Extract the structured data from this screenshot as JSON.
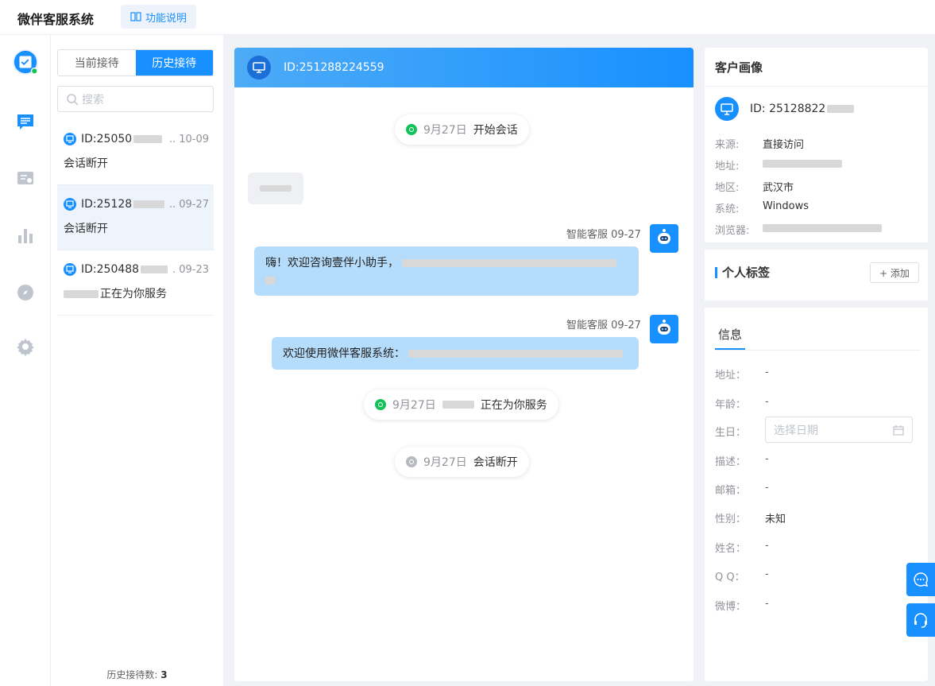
{
  "app": {
    "title": "微伴客服系统",
    "help_label": "功能说明"
  },
  "rail": {
    "items": [
      "reception",
      "chat",
      "ticket",
      "stats",
      "explore",
      "settings"
    ]
  },
  "list_panel": {
    "tabs": [
      {
        "label": "当前接待",
        "active": false
      },
      {
        "label": "历史接待",
        "active": true
      }
    ],
    "search_placeholder": "搜索",
    "sessions": [
      {
        "id": "ID:25050",
        "date": ".. 10-09",
        "message": "会话断开",
        "active": false
      },
      {
        "id": "ID:25128",
        "date": ".. 09-27",
        "message": "会话断开",
        "active": true
      },
      {
        "id": "ID:250488",
        "date": ". 09-23",
        "message": "正在为你服务",
        "active": false
      }
    ],
    "count_label": "历史接待数:",
    "count_value": "3"
  },
  "chat": {
    "header_id": "ID:251288224559",
    "system_start": {
      "date": "9月27日",
      "text": "开始会话"
    },
    "messages": [
      {
        "sender": "智能客服 09-27",
        "text": "嗨！欢迎咨询壹伴小助手，"
      },
      {
        "sender": "智能客服 09-27",
        "text": "欢迎使用微伴客服系统："
      }
    ],
    "system_serving": {
      "date": "9月27日",
      "text": "正在为你服务"
    },
    "system_end": {
      "date": "9月27日",
      "text": "会话断开"
    }
  },
  "profile": {
    "title": "客户画像",
    "id": "ID: 25128822",
    "fields": [
      {
        "key": "来源:",
        "value": "直接访问"
      },
      {
        "key": "地址:",
        "value": ""
      },
      {
        "key": "地区:",
        "value": "武汉市"
      },
      {
        "key": "系统:",
        "value": "Windows"
      },
      {
        "key": "浏览器:",
        "value": ""
      }
    ],
    "tags_title": "个人标签",
    "add_label": "+ 添加"
  },
  "info": {
    "tab": "信息",
    "fields": [
      {
        "key": "地址：",
        "value": "-"
      },
      {
        "key": "年龄：",
        "value": "-"
      },
      {
        "key": "生日：",
        "value": ""
      },
      {
        "key": "描述：",
        "value": "-"
      },
      {
        "key": "邮箱：",
        "value": "-"
      },
      {
        "key": "性别：",
        "value": "未知"
      },
      {
        "key": "姓名：",
        "value": "-"
      },
      {
        "key": "Q Q：",
        "value": "-"
      },
      {
        "key": "微博：",
        "value": "-"
      }
    ],
    "date_placeholder": "选择日期"
  },
  "colors": {
    "accent": "#1890ff",
    "online": "#13c25a",
    "bubble": "#b6dcfb"
  }
}
